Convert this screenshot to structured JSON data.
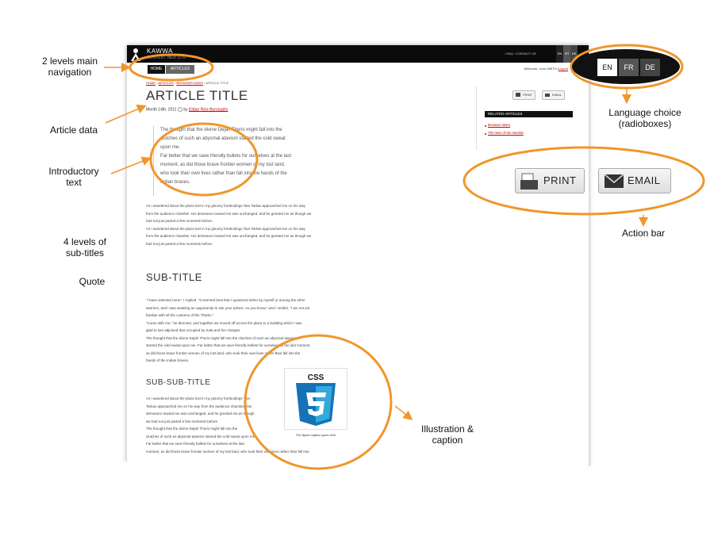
{
  "site": {
    "brand": "KAWWA",
    "tagline": "CONTENT WEB SITE"
  },
  "top_links": "› FAQ   › CONTACT US",
  "mini_lang": [
    "EN",
    "FR",
    "DE"
  ],
  "nav": {
    "home": "HOME",
    "articles": "ARTICLES"
  },
  "welcome": {
    "text": "Welcome, John SMITH |",
    "logout": "Logout"
  },
  "breadcrumb": {
    "home": "HOME",
    "articles": "ARTICLES",
    "category": "BROWSER WARS",
    "current": "› ARTICLE TITLE"
  },
  "article": {
    "title": "ARTICLE TITLE",
    "date": "Month 14th, 2011",
    "by": "by",
    "author": "Edgar Rice Burroughs",
    "intro": [
      "The thought that the divine Dejah Thoris might fall into the",
      "clutches of such an abysmal atavism started the cold sweat",
      "upon me.",
      "Far better that we save friendly bullets for ourselves at the last",
      "moment, as did those brave frontier women of my lost land,",
      "who took their own lives rather than fall into the hands of the",
      "Indian braves."
    ],
    "para1": [
      "As I wandered about the plaza lost in my gloomy forebodings Tars Tarkas approached me on his way",
      "from the audience chamber. His demeanor toward me was unchanged, and he greeted me as though we",
      "had not just parted a few moments before.",
      "     As I wandered about the plaza lost in my gloomy forebodings Tars Tarkas approached me on his way",
      "from the audience chamber. His demeanor toward me was unchanged, and he greeted me as though we",
      "had not just parted a few moments before."
    ],
    "subtitle": "SUB-TITLE",
    "para2": [
      "\"I have selected none,\" I replied. \"It seemed best that I quartered either by myself or among the other",
      "warriors, and I was awaiting an opportunity to ask your advice. As you know,\" and I smiled, \"I am not yet",
      "familiar with all the customs of the Tharks.\"",
      "     \"Come with me,\" he directed, and together we moved off across the plaza to a building which I was",
      "glad to see adjoined that occupied by Sola and her charges.",
      "     The thought that the divine Dejah Thoris might fall into the clutches of such an abysmal atavism",
      "started the cold sweat upon me. Far better that we save friendly bullets for ourselves at the last moment,",
      "as did those brave frontier women of my lost land, who took their own lives rather than fall into the",
      "hands of the Indian braves."
    ],
    "subsubtitle": "SUB-SUB-TITLE",
    "para3": [
      "As I wandered about the plaza lost in my gloomy forebodings Tars",
      "Tarkas approached me on his way from the audience chamber. His",
      "demeanor toward me was unchanged, and he greeted me as though",
      "we had not just parted a few moments before.",
      "     The thought that the divine Dejah Thoris might fall into the",
      "clutches of such an abysmal atavism started the cold sweat upon me.",
      "Far better that we save friendly bullets for ourselves at the last",
      "moment, as did those brave frontier women of my lost land, who took their own lives rather than fall into"
    ],
    "tail": "from",
    "figure_label": "CSS",
    "caption": "The figure caption goes here"
  },
  "sidebar": {
    "print": "PRINT",
    "email": "EMAIL",
    "related_title": "RELATED ARTICLES",
    "related": [
      "Browser Wars",
      "The War of the Worlds"
    ]
  },
  "zoom_lang": [
    "EN",
    "FR",
    "DE"
  ],
  "zoom_actions": {
    "print": "PRINT",
    "email": "EMAIL"
  },
  "callouts": {
    "nav": [
      "2 levels main",
      "navigation"
    ],
    "article_data": "Article data",
    "intro": [
      "Introductory",
      "text"
    ],
    "subtitles": [
      "4 levels of",
      "sub-titles"
    ],
    "quote": "Quote",
    "language": [
      "Language choice",
      "(radioboxes)"
    ],
    "action_bar": "Action bar",
    "illustration": [
      "Illustration &",
      "caption"
    ]
  },
  "colors": {
    "accent": "#F0962A",
    "link": "#CC0000",
    "bar": "#0B0B0B"
  }
}
